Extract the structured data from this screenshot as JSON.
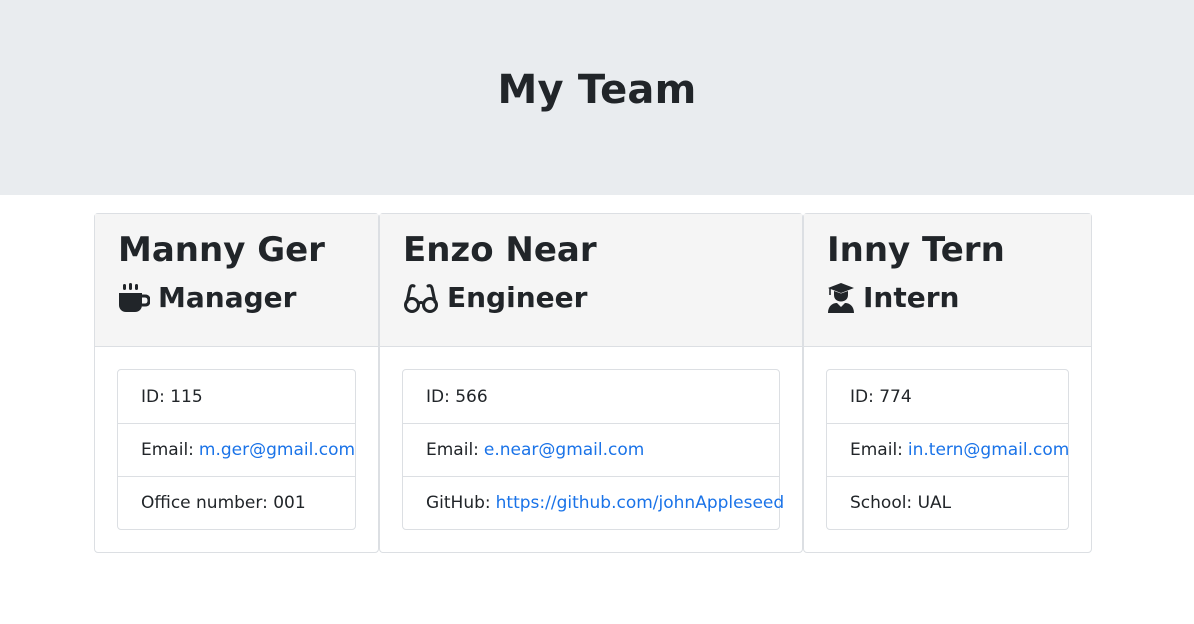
{
  "header": {
    "title": "My Team"
  },
  "colors": {
    "link": "#1a73e8",
    "jumbotron_bg": "#e9ecef",
    "card_header_bg": "#f5f5f5"
  },
  "employees": [
    {
      "name": "Manny Ger",
      "role": "Manager",
      "icon": "coffee-icon",
      "id_label": "ID: 115",
      "email_prefix": "Email:",
      "email": "m.ger@gmail.com",
      "extra_label": "Office number: 001"
    },
    {
      "name": "Enzo Near",
      "role": "Engineer",
      "icon": "glasses-icon",
      "id_label": "ID: 566",
      "email_prefix": "Email:",
      "email": "e.near@gmail.com",
      "extra_prefix": "GitHub:",
      "github": "https://github.com/johnAppleseed"
    },
    {
      "name": "Inny Tern",
      "role": "Intern",
      "icon": "graduate-icon",
      "id_label": "ID: 774",
      "email_prefix": "Email:",
      "email": "in.tern@gmail.com",
      "extra_label": "School: UAL"
    }
  ]
}
